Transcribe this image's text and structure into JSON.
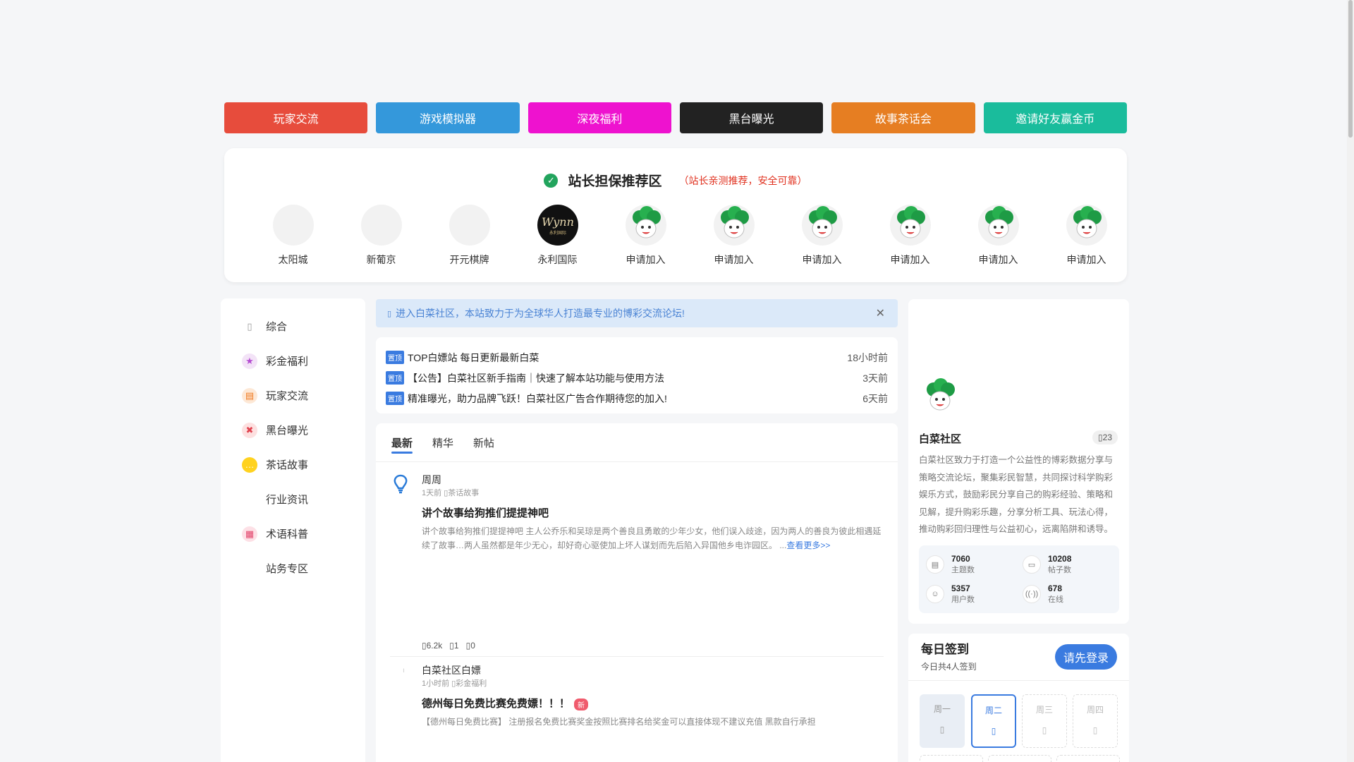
{
  "topnav": [
    {
      "label": "玩家交流",
      "color": "#e74c3c"
    },
    {
      "label": "游戏模拟器",
      "color": "#3498db"
    },
    {
      "label": "深夜福利",
      "color": "#ee12cf"
    },
    {
      "label": "黑台曝光",
      "color": "#222222"
    },
    {
      "label": "故事茶话会",
      "color": "#e67e22"
    },
    {
      "label": "邀请好友赢金币",
      "color": "#1abc9c"
    }
  ],
  "guarantee": {
    "title": "站长担保推荐区",
    "subtitle": "（站长亲测推荐，安全可靠）",
    "partners": [
      "太阳城",
      "新葡京",
      "开元棋牌",
      "永利国际",
      "申请加入",
      "申请加入",
      "申请加入",
      "申请加入",
      "申请加入",
      "申请加入"
    ]
  },
  "sidebar": {
    "items": [
      "综合",
      "彩金福利",
      "玩家交流",
      "黑台曝光",
      "茶话故事",
      "行业资讯",
      "术语科普",
      "站务专区"
    ]
  },
  "notice": {
    "text": "进入白菜社区，本站致力于为全球华人打造最专业的博彩交流论坛!",
    "close": "✕"
  },
  "pinned": {
    "tag": "置顶",
    "rows": [
      {
        "title": "TOP白嫖站 每日更新最新白菜",
        "time": "18小时前"
      },
      {
        "title": "【公告】白菜社区新手指南｜快速了解本站功能与使用方法",
        "time": "3天前"
      },
      {
        "title": "精准曝光，助力品牌飞跃！白菜社区广告合作期待您的加入!",
        "time": "6天前"
      }
    ]
  },
  "feed": {
    "tabs": [
      "最新",
      "精华",
      "新帖"
    ],
    "posts": [
      {
        "author": "周周",
        "time": "1天前",
        "category": "茶话故事",
        "title": "讲个故事给狗推们提提神吧",
        "excerpt": "讲个故事给狗推们提提神吧 主人公乔乐和吴琼是两个善良且勇敢的少年少女，他们误入歧途，因为两人的善良为彼此相遇延续了故事…两人虽然都是年少无心，却好奇心驱使加上坏人谋划而先后陷入异国他乡电诈园区。 ...",
        "more": "查看更多>>",
        "views": "6.2k",
        "replies": "1",
        "likes": "0"
      },
      {
        "author": "白菜社区白嫖",
        "time": "1小时前",
        "category": "彩金福利",
        "title": "德州每日免费比赛免费嫖！！！",
        "badge": "新",
        "excerpt": "【德州每日免费比赛】 注册报名免费比赛奖金按照比赛排名给奖金可以直接体现不建议充值 黑款自行承担"
      }
    ]
  },
  "community": {
    "name": "白菜社区",
    "badge": "23",
    "description": "白菜社区致力于打造一个公益性的博彩数据分享与策略交流论坛，聚集彩民智慧，共同探讨科学购彩娱乐方式，鼓励彩民分享自己的购彩经验、策略和见解，提升购彩乐趣，分享分析工具、玩法心得，推动购彩回归理性与公益初心，远离陷阱和诱导。",
    "stats": [
      {
        "value": "7060",
        "label": "主题数",
        "icon": "document-icon"
      },
      {
        "value": "10208",
        "label": "帖子数",
        "icon": "comment-icon"
      },
      {
        "value": "5357",
        "label": "用户数",
        "icon": "user-icon"
      },
      {
        "value": "678",
        "label": "在线",
        "icon": "signal-icon"
      }
    ]
  },
  "signin": {
    "title": "每日签到",
    "subtitle": "今日共4人签到",
    "login": "请先登录",
    "days": [
      "周一",
      "周二",
      "周三",
      "周四"
    ]
  }
}
